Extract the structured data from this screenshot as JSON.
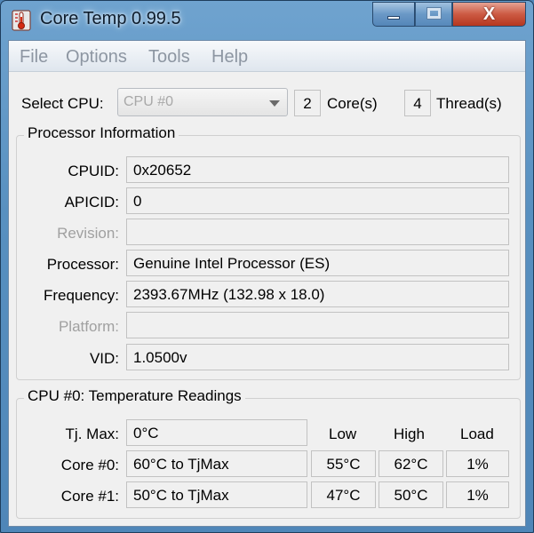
{
  "window": {
    "title": "Core Temp 0.99.5",
    "controls": {
      "close": "X"
    }
  },
  "menu": [
    "File",
    "Options",
    "Tools",
    "Help"
  ],
  "select_cpu": {
    "label": "Select CPU:",
    "value": "CPU #0",
    "cores": "2",
    "cores_label": "Core(s)",
    "threads": "4",
    "threads_label": "Thread(s)"
  },
  "processor_info": {
    "title": "Processor Information",
    "rows": [
      {
        "label": "CPUID:",
        "value": "0x20652",
        "disabled": false
      },
      {
        "label": "APICID:",
        "value": "0",
        "disabled": false
      },
      {
        "label": "Revision:",
        "value": "",
        "disabled": true
      },
      {
        "label": "Processor:",
        "value": "Genuine Intel Processor (ES)",
        "disabled": false
      },
      {
        "label": "Frequency:",
        "value": "2393.67MHz (132.98 x 18.0)",
        "disabled": false
      },
      {
        "label": "Platform:",
        "value": "",
        "disabled": true
      },
      {
        "label": "VID:",
        "value": "1.0500v",
        "disabled": false
      }
    ]
  },
  "temps": {
    "title": "CPU #0: Temperature Readings",
    "tjmax_label": "Tj. Max:",
    "tjmax_value": "0°C",
    "headers": {
      "low": "Low",
      "high": "High",
      "load": "Load"
    },
    "cores": [
      {
        "label": "Core #0:",
        "temp": "60°C to TjMax",
        "low": "55°C",
        "high": "62°C",
        "load": "1%"
      },
      {
        "label": "Core #1:",
        "temp": "50°C to TjMax",
        "low": "47°C",
        "high": "50°C",
        "load": "1%"
      }
    ]
  }
}
